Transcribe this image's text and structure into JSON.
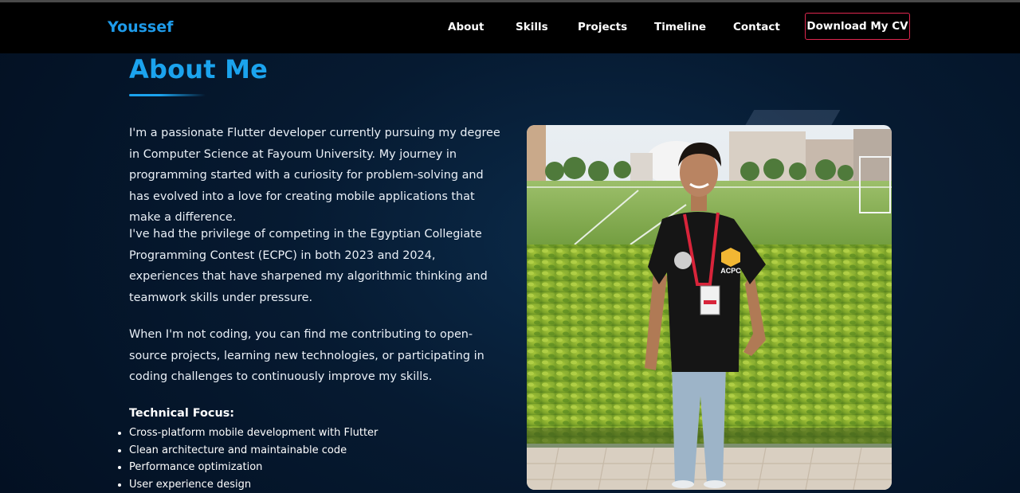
{
  "nav": {
    "brand": "Youssef",
    "links": [
      "About",
      "Skills",
      "Projects",
      "Timeline",
      "Contact"
    ],
    "cta": "Download My CV"
  },
  "about": {
    "title": "About Me",
    "paragraphs": [
      "I'm a passionate Flutter developer currently pursuing my degree in Computer Science at Fayoum University. My journey in programming started with a curiosity for problem-solving and has evolved into a love for creating mobile applications that make a difference.",
      "I've had the privilege of competing in the Egyptian Collegiate Programming Contest (ECPC) in both 2023 and 2024, experiences that have sharpened my algorithmic thinking and teamwork skills under pressure.",
      "When I'm not coding, you can find me contributing to open-source projects, learning new technologies, or participating in coding challenges to continuously improve my skills."
    ],
    "focus_title": "Technical Focus:",
    "focus_items": [
      "Cross-platform mobile development with Flutter",
      "Clean architecture and maintainable code",
      "Performance optimization",
      "User experience design"
    ],
    "photo_badge": "ACPC"
  },
  "colors": {
    "accent": "#1ba3ee",
    "cta_border": "#e0274f",
    "background": "#061a31"
  }
}
